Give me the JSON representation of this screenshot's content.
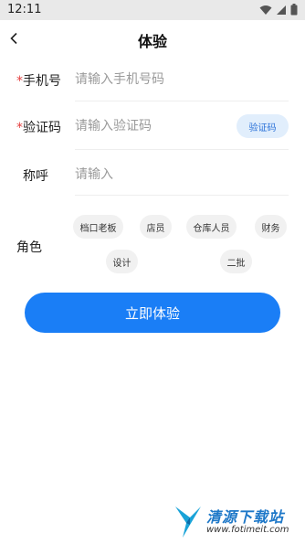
{
  "status_bar": {
    "time": "12:11"
  },
  "header": {
    "title": "体验"
  },
  "form": {
    "phone": {
      "required_mark": "*",
      "label": "手机号",
      "placeholder": "请输入手机号码",
      "value": ""
    },
    "code": {
      "required_mark": "*",
      "label": "验证码",
      "placeholder": "请输入验证码",
      "value": "",
      "button_label": "验证码"
    },
    "nickname": {
      "label": "称呼",
      "placeholder": "请输入",
      "value": ""
    },
    "role": {
      "label": "角色",
      "options": [
        "档口老板",
        "店员",
        "仓库人员",
        "财务",
        "设计",
        "二批"
      ]
    }
  },
  "submit_label": "立即体验",
  "watermark": {
    "text": "清源下载站",
    "url": "www.fotimeit.com"
  },
  "colors": {
    "accent": "#1a7ef6",
    "required": "#e44040",
    "code_button_bg": "#e1eefc",
    "chip_bg": "#f1f1f1"
  }
}
